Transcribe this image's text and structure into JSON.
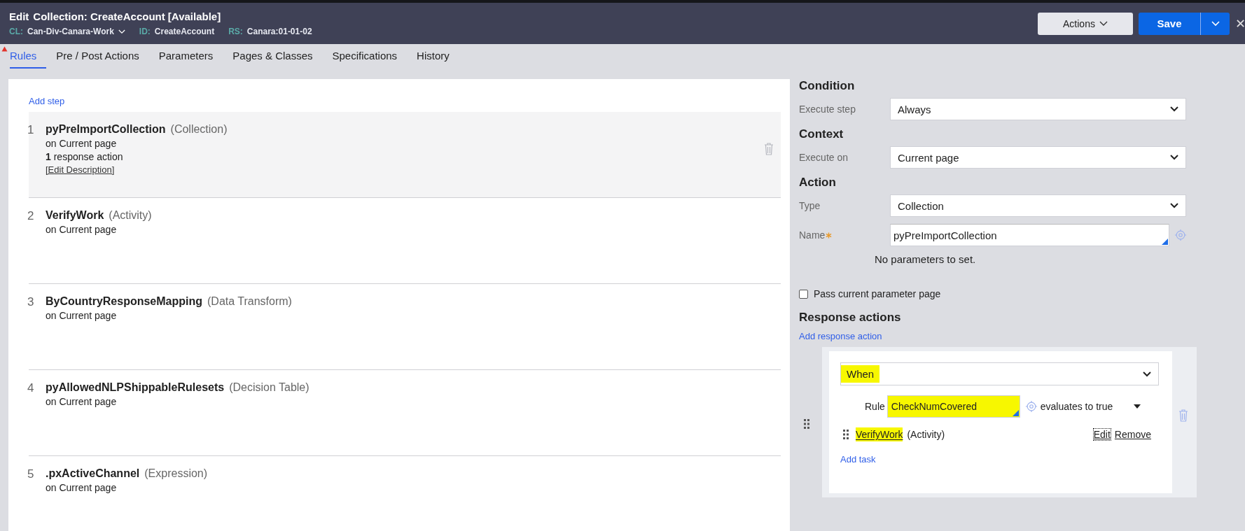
{
  "header": {
    "edit_label": "Edit",
    "title": "Collection: CreateAccount [Available]",
    "meta": [
      {
        "key": "CL:",
        "value": "Can-Div-Canara-Work",
        "dropdown": true
      },
      {
        "key": "ID:",
        "value": "CreateAccount",
        "dropdown": false
      },
      {
        "key": "RS:",
        "value": "Canara:01-01-02",
        "dropdown": false
      }
    ],
    "actions_button": "Actions",
    "save_button": "Save",
    "close": "✕"
  },
  "tabs": [
    {
      "label": "Rules",
      "selected": true,
      "warning": true
    },
    {
      "label": "Pre / Post Actions",
      "selected": false,
      "warning": false
    },
    {
      "label": "Parameters",
      "selected": false,
      "warning": false
    },
    {
      "label": "Pages & Classes",
      "selected": false,
      "warning": false
    },
    {
      "label": "Specifications",
      "selected": false,
      "warning": false
    },
    {
      "label": "History",
      "selected": false,
      "warning": false
    }
  ],
  "add_step": "Add step",
  "steps": [
    {
      "number": "1",
      "name": "pyPreImportCollection",
      "type": "(Collection)",
      "context": "on Current page",
      "extra": "**1** response action",
      "link": "[Edit Description]",
      "selected": true
    },
    {
      "number": "2",
      "name": "VerifyWork",
      "type": "(Activity)",
      "context": "on Current page",
      "selected": false
    },
    {
      "number": "3",
      "name": "ByCountryResponseMapping",
      "type": "(Data Transform)",
      "context": "on Current page",
      "selected": false
    },
    {
      "number": "4",
      "name": "pyAllowedNLPShippableRulesets",
      "type": "(Decision Table)",
      "context": "on Current page",
      "selected": false
    },
    {
      "number": "5",
      "name": ".pxActiveChannel",
      "type": "(Expression)",
      "context": "on Current page",
      "selected": false
    }
  ],
  "detail": {
    "sections": [
      {
        "heading": "Condition",
        "fields": [
          {
            "label": "Execute step",
            "value": "Always",
            "kind": "select",
            "required": false
          }
        ]
      },
      {
        "heading": "Context",
        "fields": [
          {
            "label": "Execute on",
            "value": "Current page",
            "kind": "select",
            "required": false
          }
        ]
      },
      {
        "heading": "Action",
        "fields": [
          {
            "label": "Type",
            "value": "Collection",
            "kind": "select",
            "required": false
          },
          {
            "label": "Name",
            "value": "pyPreImportCollection",
            "kind": "lookup",
            "required": true
          }
        ]
      }
    ],
    "no_params": "No parameters to set.",
    "pass_param": {
      "label": "Pass current parameter page",
      "checked": false
    },
    "response_heading": "Response actions",
    "add_response": "Add response action",
    "response": {
      "when": {
        "value": "When",
        "highlighted": true
      },
      "rule_label": "Rule",
      "rule_value": "CheckNumCovered",
      "rule_highlighted": true,
      "evaluates": "evaluates to true",
      "task": {
        "name": "VerifyWork",
        "type": "(Activity)",
        "highlighted": true,
        "edit": "Edit",
        "remove": "Remove"
      },
      "add_task": "Add task"
    }
  }
}
